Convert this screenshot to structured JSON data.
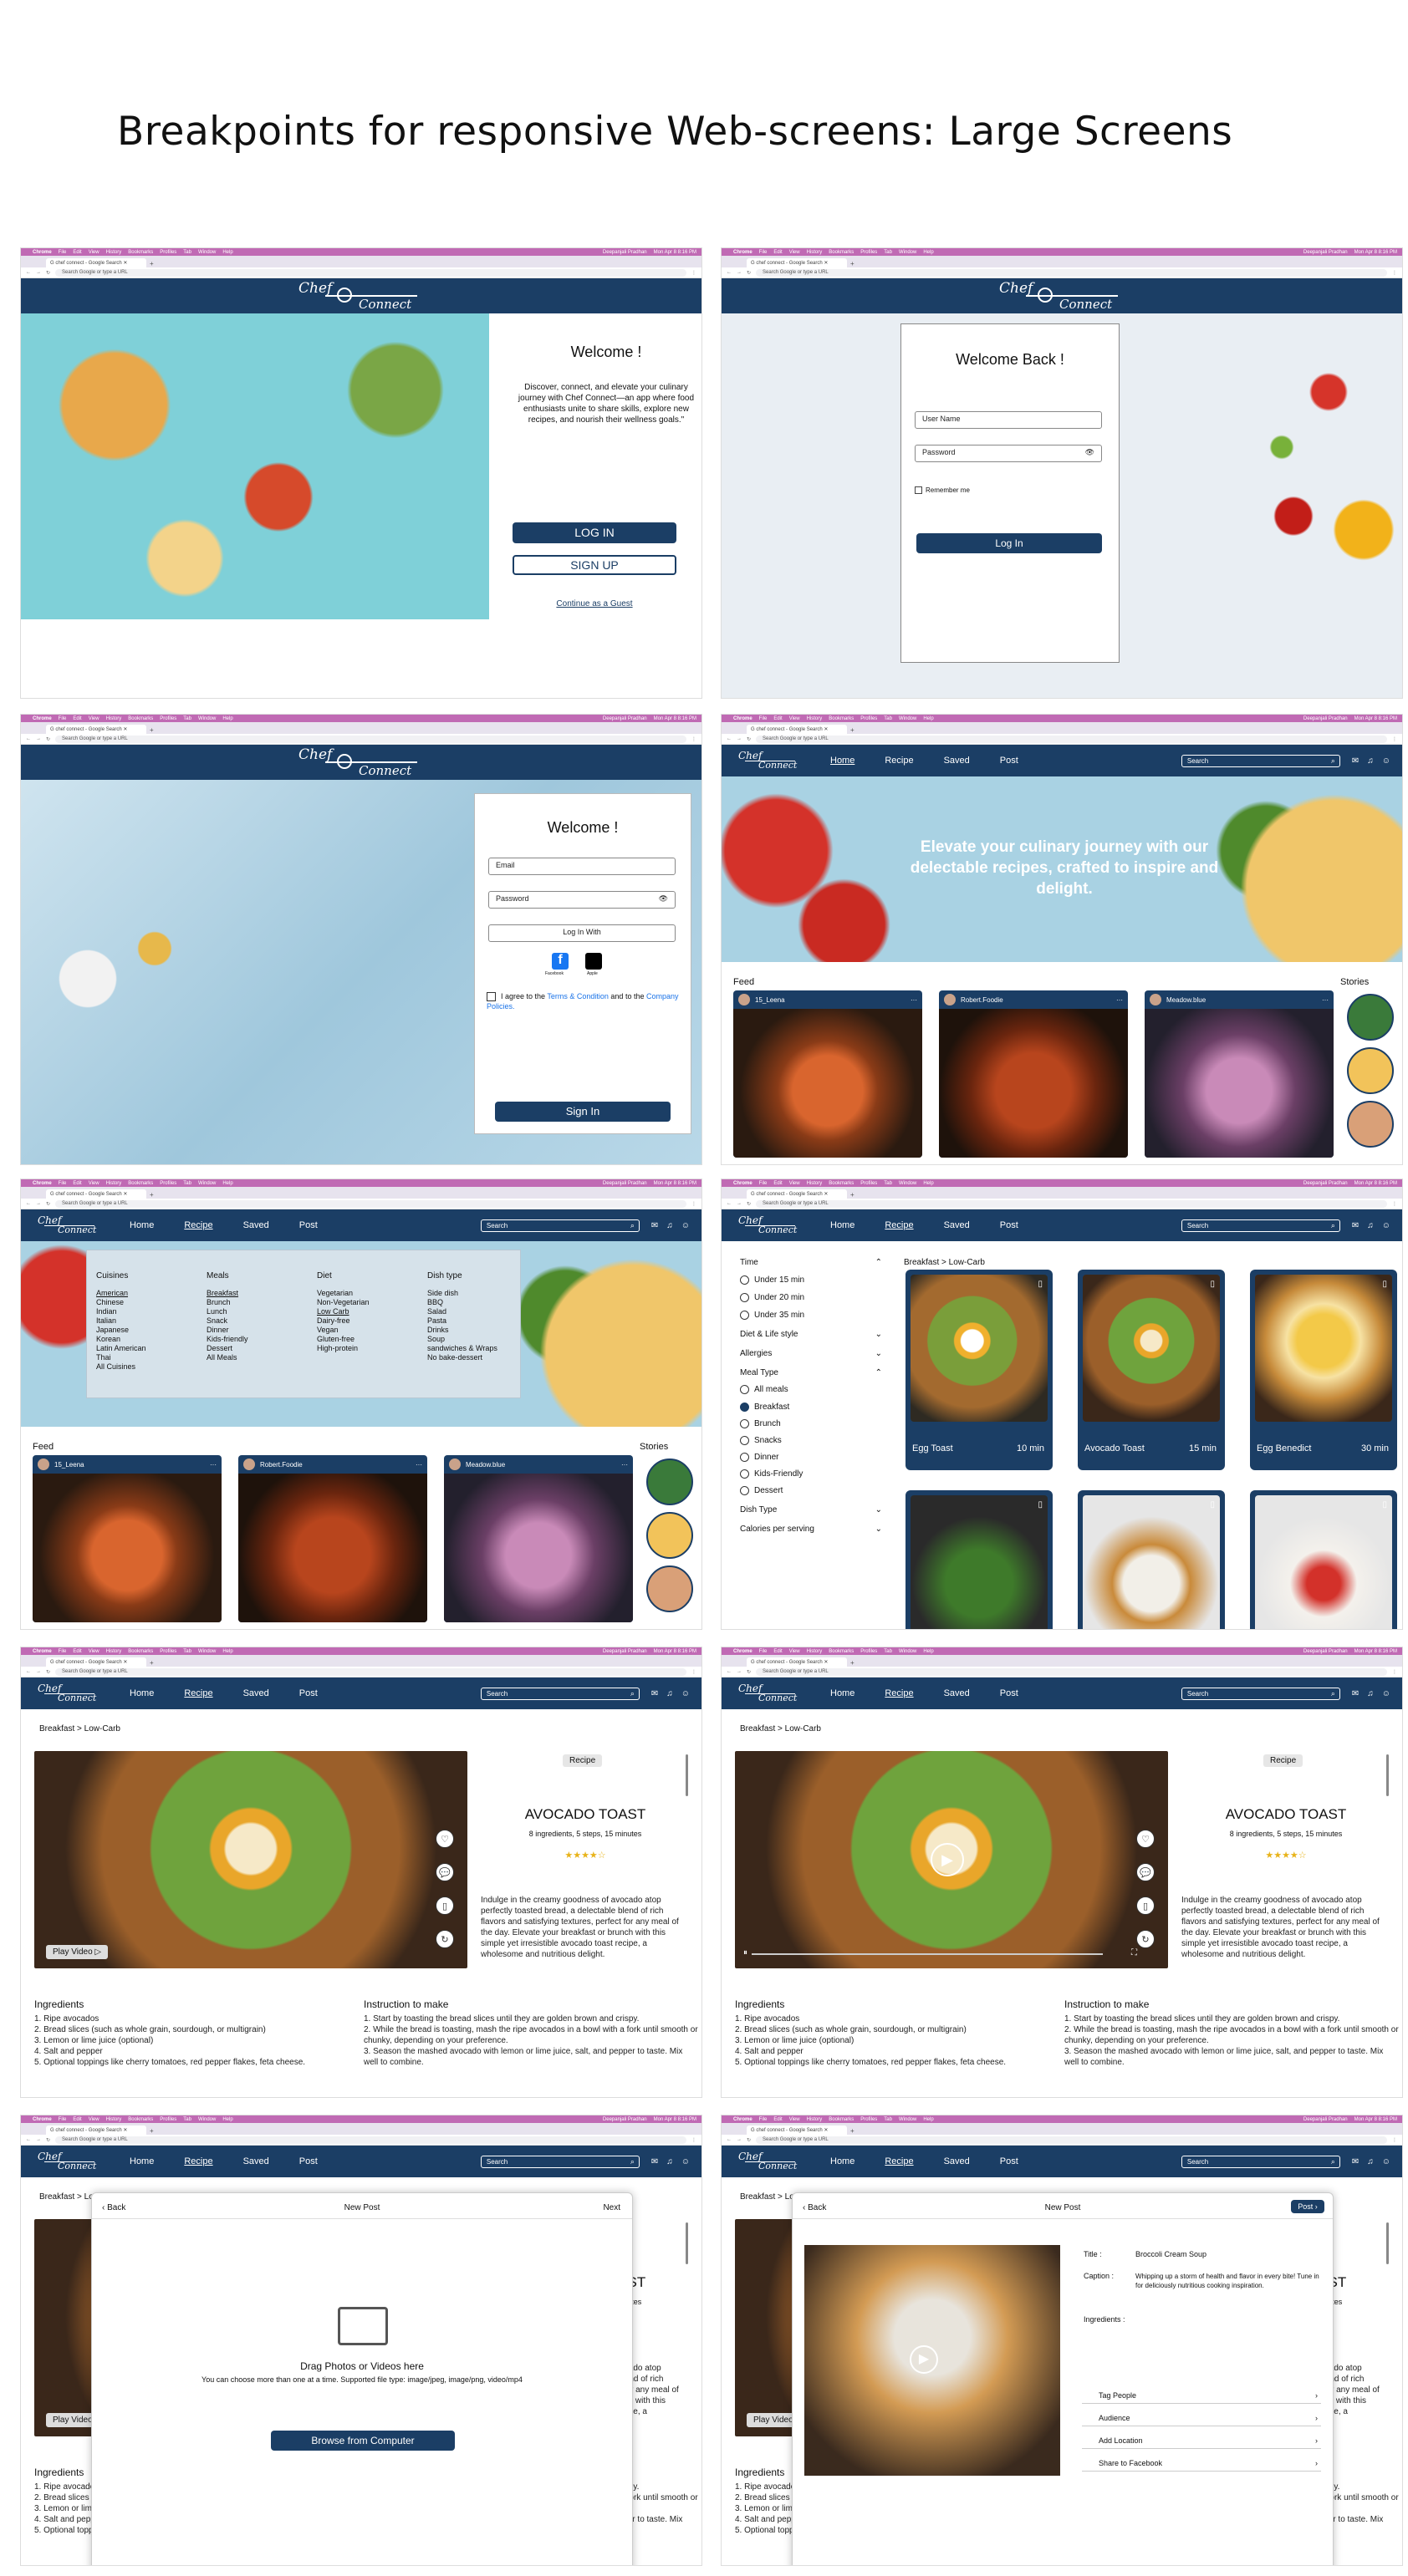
{
  "page_title": "Breakpoints for responsive Web-screens: Large Screens",
  "os": {
    "app": "Chrome",
    "menus": [
      "File",
      "Edit",
      "View",
      "History",
      "Bookmarks",
      "Profiles",
      "Tab",
      "Window",
      "Help"
    ],
    "user": "Deepanjali Pradhan",
    "datetime": "Mon Apr 8  8:16 PM"
  },
  "browser": {
    "tab_title": "chef connect - Google Search",
    "url_placeholder": "Search Google or type a URL"
  },
  "brand": {
    "line1": "Chef",
    "line2": "Connect"
  },
  "nav": {
    "items": [
      "Home",
      "Recipe",
      "Saved",
      "Post"
    ],
    "search_placeholder": "Search"
  },
  "landing": {
    "heading": "Welcome !",
    "body": "Discover, connect, and elevate your culinary journey with Chef Connect—an app where food enthusiasts unite to share skills, explore new recipes, and nourish their wellness goals.\"",
    "login": "LOG IN",
    "signup": "SIGN UP",
    "guest": "Continue as a Guest"
  },
  "login": {
    "heading": "Welcome Back !",
    "username": "User Name",
    "password": "Password",
    "remember": "Remember me",
    "button": "Log In"
  },
  "signup": {
    "heading": "Welcome !",
    "email": "Email",
    "password": "Password",
    "login_with": "Log In With",
    "fb": "Facebook",
    "apple": "Apple",
    "agree_pre": "I agree to the ",
    "terms": "Terms & Condition",
    "agree_mid": " and to the ",
    "policy": "Company Policies.",
    "button": "Sign In"
  },
  "home": {
    "hero": "Elevate your culinary journey with our delectable recipes, crafted to inspire and delight.",
    "feed": "Feed",
    "stories": "Stories",
    "users": [
      "15_Leena",
      "Robert.Foodie",
      "Meadow.blue"
    ]
  },
  "mega": {
    "cols": [
      {
        "title": "Cuisines",
        "items": [
          "American",
          "Chinese",
          "Indian",
          "Italian",
          "Japanese",
          "Korean",
          "Latin American",
          "Thai",
          "All Cuisines"
        ]
      },
      {
        "title": "Meals",
        "items": [
          "Breakfast",
          "Brunch",
          "Lunch",
          "Snack",
          "Dinner",
          "Kids-friendly",
          "Dessert",
          "All Meals"
        ]
      },
      {
        "title": "Diet",
        "items": [
          "Vegetarian",
          "Non-Vegetarian",
          "Low Carb",
          "Dairy-free",
          "Vegan",
          "Gluten-free",
          "High-protein"
        ]
      },
      {
        "title": "Dish type",
        "items": [
          "Side dish",
          "BBQ",
          "Salad",
          "Pasta",
          "Drinks",
          "Soup",
          "sandwiches & Wraps",
          "No bake-dessert"
        ]
      }
    ]
  },
  "filters": {
    "time": "Time",
    "times": [
      "Under 15 min",
      "Under 20 min",
      "Under 35 min"
    ],
    "diet": "Diet & Life style",
    "allergies": "Allergies",
    "meal": "Meal Type",
    "meals": [
      "All meals",
      "Breakfast",
      "Brunch",
      "Snacks",
      "Dinner",
      "Kids-Friendly",
      "Dessert"
    ],
    "dish": "Dish Type",
    "cal": "Calories per serving",
    "crumb": "Breakfast > Low-Carb",
    "recipes": [
      {
        "name": "Egg Toast",
        "time": "10 min"
      },
      {
        "name": "Avocado Toast",
        "time": "15 min"
      },
      {
        "name": "Egg Benedict",
        "time": "30 min"
      }
    ]
  },
  "recipe": {
    "crumb": "Breakfast > Low-Carb",
    "badge": "Recipe",
    "title": "AVOCADO TOAST",
    "meta": "8 ingredients, 5 steps, 15 minutes",
    "stars": "★★★★☆",
    "desc": "Indulge in the creamy goodness of avocado atop perfectly toasted bread, a delectable blend of rich flavors and satisfying textures, perfect for any meal of the day. Elevate your breakfast or brunch with this simple yet irresistible avocado toast recipe, a wholesome and nutritious delight.",
    "play": "Play Video ▷",
    "ing_title": "Ingredients",
    "ing": [
      "1. Ripe avocados",
      "2. Bread slices (such as whole grain, sourdough, or multigrain)",
      "3. Lemon or lime juice (optional)",
      "4. Salt and pepper",
      "5. Optional toppings like cherry tomatoes, red pepper flakes, feta cheese."
    ],
    "ins_title": "Instruction to make",
    "ins": [
      "1. Start by toasting the bread slices until they are golden brown and crispy.",
      "2. While the bread is toasting, mash the ripe avocados in a bowl with a fork   until smooth or chunky, depending on your preference.",
      "3. Season the mashed avocado with lemon or lime juice, salt, and pepper to taste. Mix well to combine."
    ]
  },
  "post": {
    "back": "Back",
    "title": "New Post",
    "next": "Next",
    "drag": "Drag Photos or Videos here",
    "hint": "You can choose more than one at a time. Supported file type: image/jpeg, image/png, video/mp4",
    "browse": "Browse from Computer",
    "post_btn": "Post",
    "f_title": "Title :",
    "f_title_val": "Broccoli Cream Soup",
    "f_caption": "Caption :",
    "f_caption_val": "Whipping up a storm of health and flavor in every bite! Tune in for deliciously nutritious cooking inspiration.",
    "f_ing": "Ingredients :",
    "opts": [
      "Tag People",
      "Audience",
      "Add Location",
      "Share to Facebook"
    ]
  },
  "colors": {
    "navy": "#1b3e65",
    "os": "#c06ab4",
    "ice": "#9fc7dc"
  }
}
